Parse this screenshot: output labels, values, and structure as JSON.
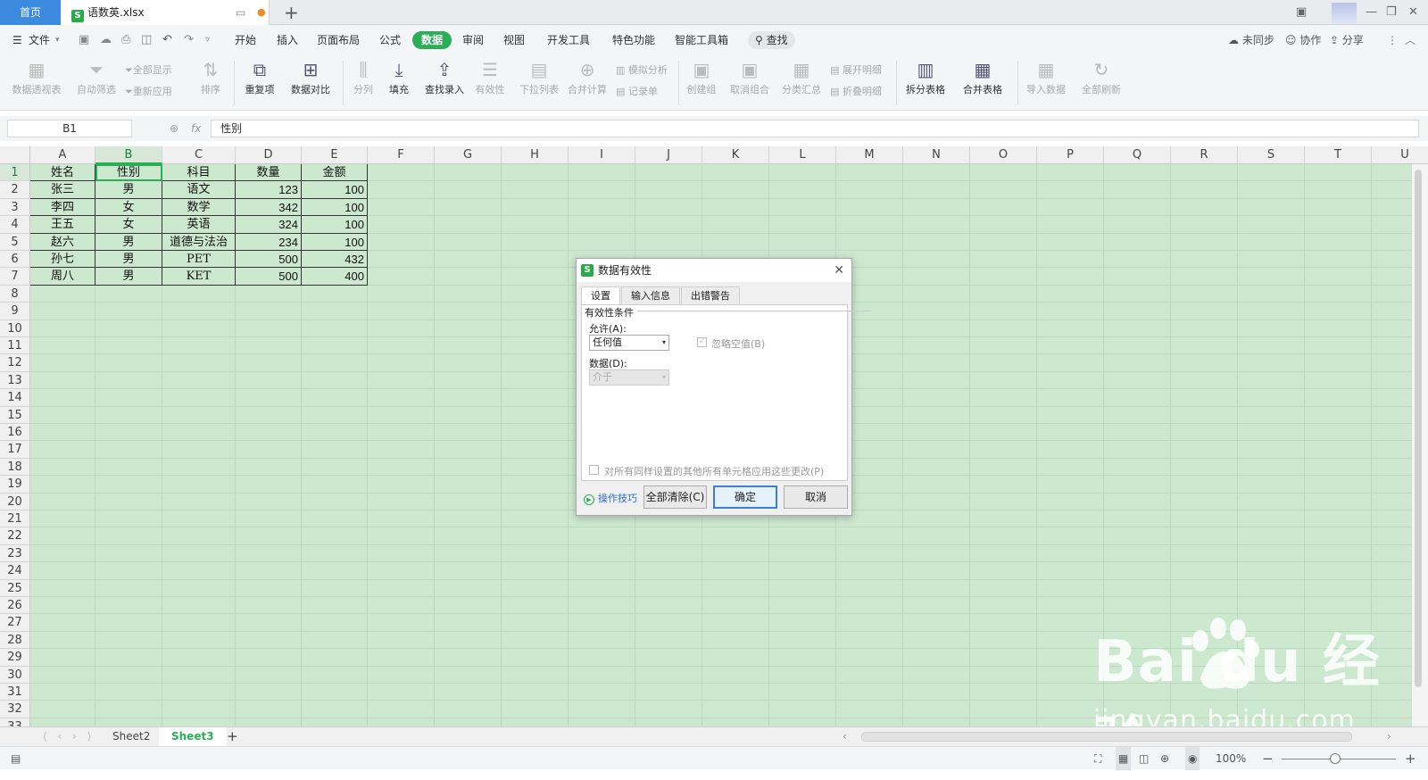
{
  "tabs": {
    "home": "首页",
    "file": "语数英.xlsx"
  },
  "menu": {
    "file": "文件",
    "items": [
      "开始",
      "插入",
      "页面布局",
      "公式",
      "数据",
      "审阅",
      "视图",
      "开发工具",
      "特色功能",
      "智能工具箱"
    ],
    "active": "数据",
    "search": "查找",
    "right": {
      "sync": "未同步",
      "collab": "协作",
      "share": "分享"
    }
  },
  "ribbon": {
    "pivot": "数据透视表",
    "autofilter": "自动筛选",
    "show_all": "全部显示",
    "reapply": "重新应用",
    "sort": "排序",
    "duplicates": "重复项",
    "compare": "数据对比",
    "split": "分列",
    "fill": "填充",
    "lookup": "查找录入",
    "validity": "有效性",
    "dropdown": "下拉列表",
    "consolidate": "合并计算",
    "simulate": "模拟分析",
    "record": "记录单",
    "group": "创建组",
    "ungroup": "取消组合",
    "subtotal": "分类汇总",
    "expand": "展开明细",
    "collapse": "折叠明细",
    "split_table": "拆分表格",
    "merge_table": "合并表格",
    "import": "导入数据",
    "refresh": "全部刷新"
  },
  "formula_bar": {
    "cell_ref": "B1",
    "fx": "fx",
    "value": "性别"
  },
  "columns": [
    "A",
    "B",
    "C",
    "D",
    "E",
    "F",
    "G",
    "H",
    "I",
    "J",
    "K",
    "L",
    "M",
    "N",
    "O",
    "P",
    "Q",
    "R",
    "S",
    "T",
    "U"
  ],
  "rows": [
    "1",
    "2",
    "3",
    "4",
    "5",
    "6",
    "7",
    "8",
    "9",
    "10",
    "11",
    "12",
    "13",
    "14",
    "15",
    "16",
    "17",
    "18",
    "19",
    "20",
    "21",
    "22",
    "23",
    "24",
    "25",
    "26",
    "27",
    "28",
    "29",
    "30",
    "31",
    "32",
    "33"
  ],
  "table": {
    "header": [
      "姓名",
      "性别",
      "科目",
      "数量",
      "金额"
    ],
    "rows": [
      [
        "张三",
        "男",
        "语文",
        "123",
        "100"
      ],
      [
        "李四",
        "女",
        "数学",
        "342",
        "100"
      ],
      [
        "王五",
        "女",
        "英语",
        "324",
        "100"
      ],
      [
        "赵六",
        "男",
        "道德与法治",
        "234",
        "100"
      ],
      [
        "孙七",
        "男",
        "PET",
        "500",
        "432"
      ],
      [
        "周八",
        "男",
        "KET",
        "500",
        "400"
      ]
    ]
  },
  "dialog": {
    "title": "数据有效性",
    "tabs": [
      "设置",
      "输入信息",
      "出错警告"
    ],
    "group_label": "有效性条件",
    "allow_label": "允许(A):",
    "allow_value": "任何值",
    "ignore_blank": "忽略空值(B)",
    "data_label": "数据(D):",
    "data_value": "介于",
    "apply_all": "对所有同样设置的其他所有单元格应用这些更改(P)",
    "tips": "操作技巧",
    "clear_all": "全部清除(C)",
    "ok": "确定",
    "cancel": "取消"
  },
  "sheets": {
    "tabs": [
      "Sheet2",
      "Sheet3"
    ],
    "active": "Sheet3"
  },
  "status": {
    "zoom": "100%"
  },
  "watermark": {
    "logo": "Bai du 经验",
    "url": "jingyan.baidu.com"
  },
  "colors": {
    "accent": "#2bae57",
    "sheet_bg": "#cce8cf",
    "home_tab": "#3d8be0",
    "arrow": "#e53935"
  }
}
